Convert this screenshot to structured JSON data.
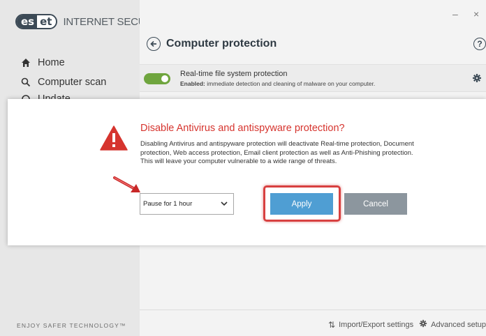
{
  "app": {
    "logo_left": "es",
    "logo_right": "et",
    "product_name": "INTERNET SECURITY",
    "window_minimize": "–",
    "window_close": "×",
    "footer_tagline": "ENJOY SAFER TECHNOLOGY™"
  },
  "sidebar": {
    "items": [
      {
        "label": "Home",
        "icon": "home-icon"
      },
      {
        "label": "Computer scan",
        "icon": "search-icon"
      },
      {
        "label": "Update",
        "icon": "update-icon"
      }
    ]
  },
  "page": {
    "title": "Computer protection",
    "help": "?",
    "feature": {
      "title": "Real-time file system protection",
      "status_label": "Enabled:",
      "status_text": "immediate detection and cleaning of malware on your computer.",
      "enabled": true
    }
  },
  "footer": {
    "import_export": "Import/Export settings",
    "advanced_setup": "Advanced setup"
  },
  "dialog": {
    "title": "Disable Antivirus and antispyware protection?",
    "body": "Disabling Antivirus and antispyware protection will deactivate Real-time protection, Document protection, Web access protection, Email client protection as well as Anti-Phishing protection. This will leave your computer vulnerable to a wide range of threats.",
    "duration_selected": "Pause for 1 hour",
    "apply_label": "Apply",
    "cancel_label": "Cancel"
  },
  "colors": {
    "alert_red": "#d6342e",
    "apply_blue": "#4f9ed3",
    "cancel_gray": "#8c969e",
    "toggle_green": "#6fa53e",
    "highlight_red": "#d84040"
  }
}
